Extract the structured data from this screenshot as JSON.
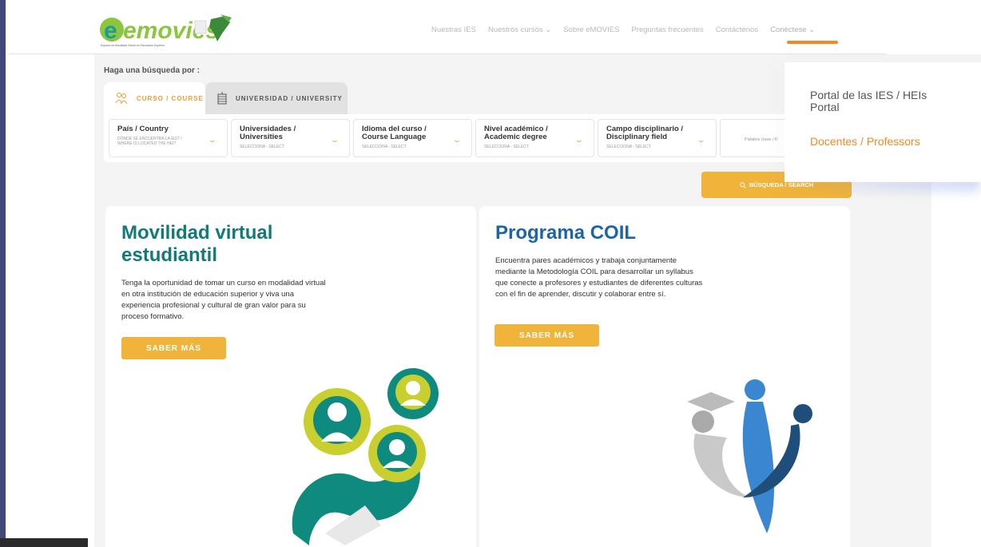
{
  "brand": {
    "logo_text": "emovies",
    "logo_tagline": "Espacio de Movilidad Virtual en Educación Superior"
  },
  "nav": {
    "items": [
      "Nuestras IES",
      "Nuestros cursos ⌄",
      "Sobre eMOVIES",
      "Preguntas frecuentes",
      "Contáctenos",
      "Conéctese ⌄"
    ]
  },
  "search": {
    "label": "Haga una búsqueda por :",
    "tabs": [
      "CURSO / COURSE",
      "UNIVERSIDAD / UNIVERSITY"
    ],
    "filters": [
      {
        "title": "País / Country",
        "sub": "DÓNDE SE ENCUENTRA LA IES? /\nWHERE IS LOCATED THE HEI?"
      },
      {
        "title": "Universidades /\nUniversities",
        "sub": "SELECCIONA - SELECT"
      },
      {
        "title": "Idioma del curso /\nCourse Language",
        "sub": "SELECCIONA - SELECT"
      },
      {
        "title": "Nivel académico /\nAcademic degree",
        "sub": "SELECCIONA - SELECT"
      },
      {
        "title": "Campo disciplinario /\nDisciplinary field",
        "sub": "SELECCIONA - SELECT"
      }
    ],
    "keyword_placeholder": "Palabra clave / K",
    "button_label": "BÚSQUEDA / SEARCH"
  },
  "dropdown": {
    "items": [
      "Portal de las IES / HEIs Portal",
      "Docentes / Professors"
    ]
  },
  "cards": [
    {
      "title": "Movilidad virtual estudiantil",
      "text": "Tenga la oportunidad de tomar un curso en modalidad virtual en otra institución de educación superior y viva una experiencia profesional y cultural de gran valor para su proceso formativo.",
      "button": "SABER MÁS"
    },
    {
      "title": "Programa COIL",
      "text": "Encuentra pares académicos y trabaja conjuntamente mediante la Metodología COIL para desarrollar un syllabus que conecte a profesores y estudiantes de diferentes culturas con el fin de aprender, discutir y colaborar entre sí.",
      "button": "SABER MÁS"
    }
  ],
  "colors": {
    "accent_orange": "#f08a24",
    "button_yellow": "#f1b43a",
    "teal": "#127a78",
    "blue": "#1e65a8"
  }
}
